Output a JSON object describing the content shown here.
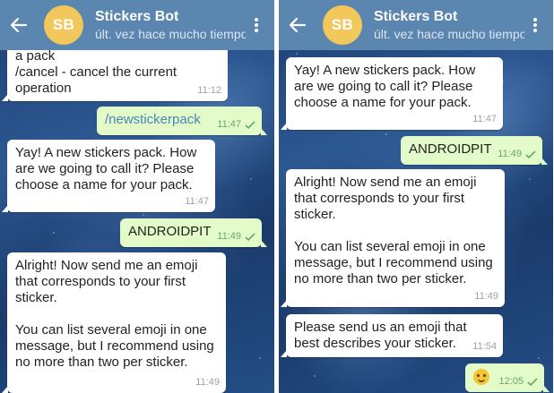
{
  "header": {
    "title": "Stickers Bot",
    "subtitle": "últ. vez hace mucho tiempo",
    "avatar_initials": "SB",
    "avatar_color": "#f2c75c",
    "bar_color": "#5b86b0",
    "back_icon": "arrow-left",
    "menu_icon": "more-vertical"
  },
  "left": {
    "messages": [
      {
        "text": "a pack\n/cancel - cancel the current operation",
        "time": "11:12"
      },
      {
        "text": "/newstickerpack",
        "time": "11:47"
      },
      {
        "text": "Yay! A new stickers pack. How are we going to call it? Please choose a name for your pack.",
        "time": "11:47"
      },
      {
        "text": "ANDROIDPIT",
        "time": "11:49"
      },
      {
        "text": "Alright! Now send me an emoji that corresponds to your first sticker.\n\nYou can list several emoji in one message, but I recommend using no more than two per sticker.",
        "time": "11:49"
      }
    ]
  },
  "right": {
    "messages": [
      {
        "text": "Yay! A new stickers pack. How are we going to call it? Please choose a name for your pack.",
        "time": "11:47"
      },
      {
        "text": "ANDROIDPIT",
        "time": "11:49"
      },
      {
        "text": "Alright! Now send me an emoji that corresponds to your first sticker.\n\nYou can list several emoji in one message, but I recommend using no more than two per sticker.",
        "time": "11:49"
      },
      {
        "text": "Please send us an emoji that best describes your sticker.",
        "time": "11:54"
      },
      {
        "emoji": "grinning-face",
        "time": "12:05"
      }
    ]
  },
  "colors": {
    "incoming_bubble": "#ffffff",
    "outgoing_bubble": "#e3fbc8",
    "outgoing_meta": "#6aa86a"
  }
}
